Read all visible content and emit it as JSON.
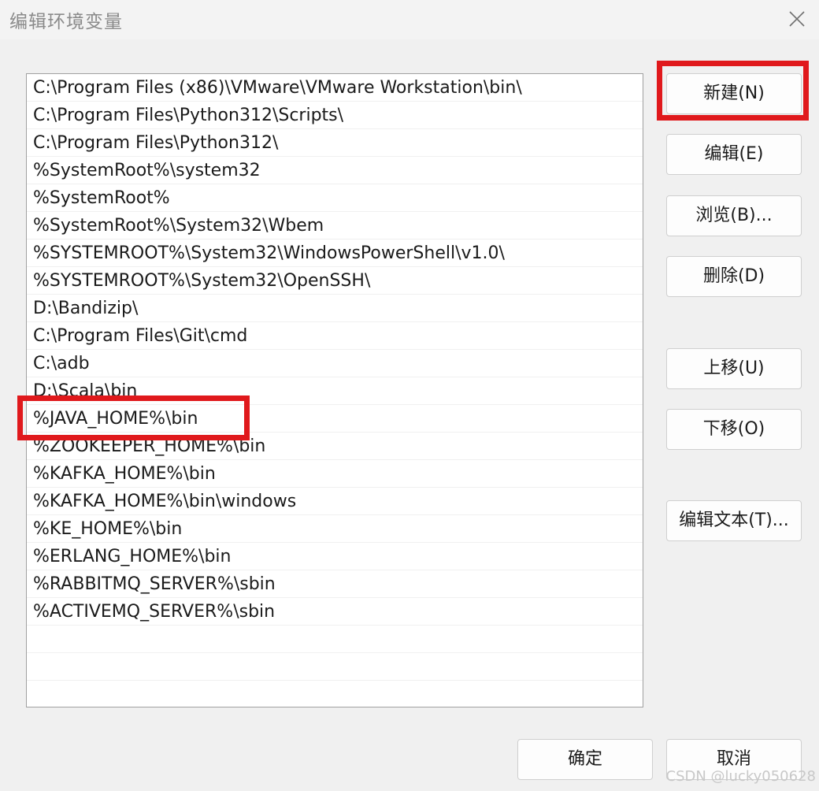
{
  "window": {
    "title": "编辑环境变量",
    "close_icon": "close-icon"
  },
  "path_list": {
    "items": [
      "C:\\Program Files (x86)\\VMware\\VMware Workstation\\bin\\",
      "C:\\Program Files\\Python312\\Scripts\\",
      "C:\\Program Files\\Python312\\",
      "%SystemRoot%\\system32",
      "%SystemRoot%",
      "%SystemRoot%\\System32\\Wbem",
      "%SYSTEMROOT%\\System32\\WindowsPowerShell\\v1.0\\",
      "%SYSTEMROOT%\\System32\\OpenSSH\\",
      "D:\\Bandizip\\",
      "C:\\Program Files\\Git\\cmd",
      "C:\\adb",
      "D:\\Scala\\bin",
      "%JAVA_HOME%\\bin",
      "%ZOOKEEPER_HOME%\\bin",
      "%KAFKA_HOME%\\bin",
      "%KAFKA_HOME%\\bin\\windows",
      "%KE_HOME%\\bin",
      "%ERLANG_HOME%\\bin",
      "%RABBITMQ_SERVER%\\sbin",
      "%ACTIVEMQ_SERVER%\\sbin",
      "",
      "",
      ""
    ]
  },
  "buttons": {
    "new": "新建(N)",
    "edit": "编辑(E)",
    "browse": "浏览(B)...",
    "delete": "删除(D)",
    "move_up": "上移(U)",
    "move_down": "下移(O)",
    "edit_text": "编辑文本(T)...",
    "ok": "确定",
    "cancel": "取消"
  },
  "watermark": "CSDN @lucky050628",
  "colors": {
    "highlight": "#e0191c",
    "background": "#f0f0f0"
  }
}
